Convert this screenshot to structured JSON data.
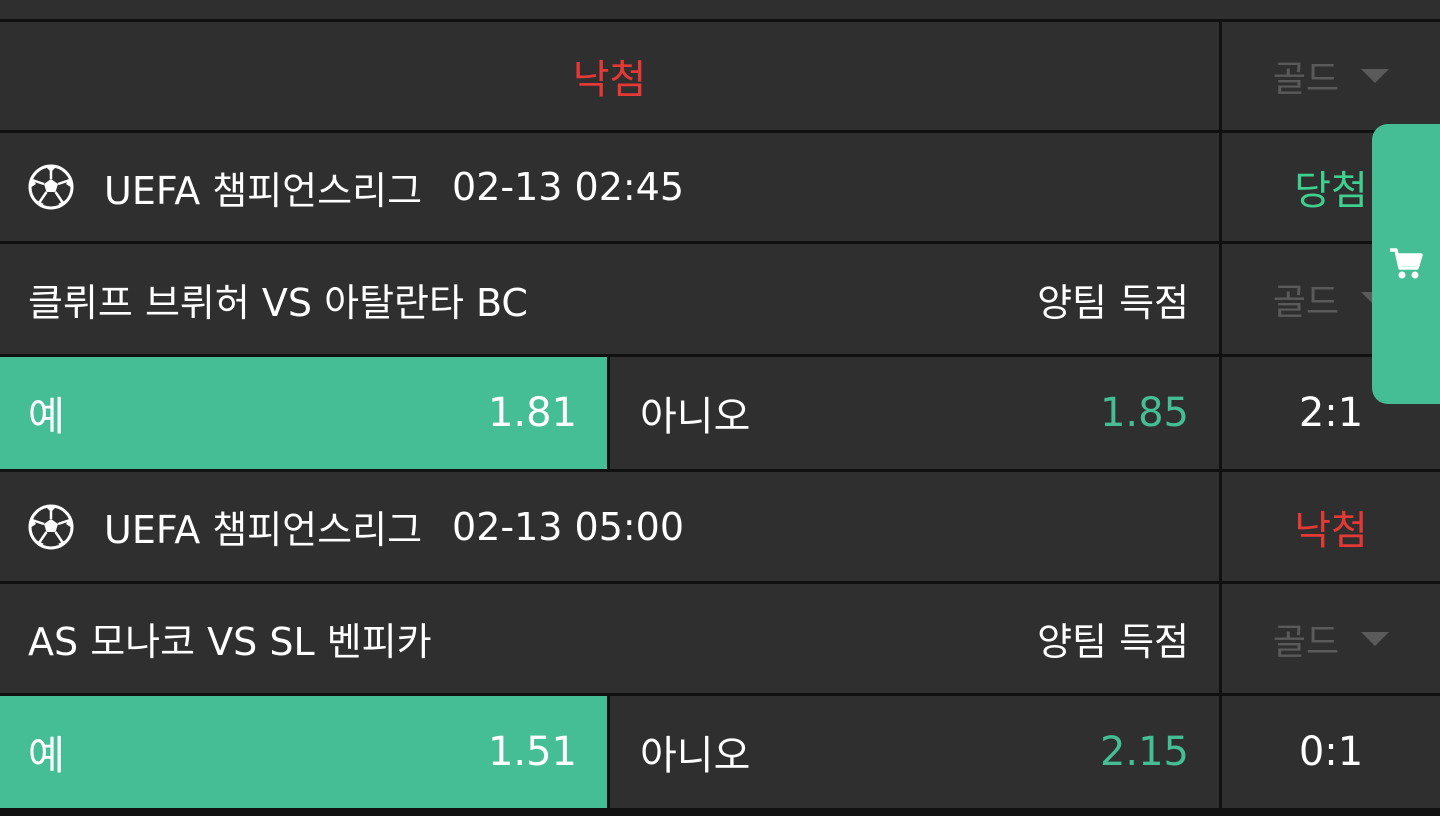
{
  "colors": {
    "accent": "#45be95",
    "win": "#3fcf8e",
    "lose": "#e53935",
    "cell_bg": "#2f2f2f",
    "muted": "#5a5a5a"
  },
  "summary": {
    "status": "낙첨",
    "grade_label": "골드"
  },
  "matches": [
    {
      "league": "UEFA 챔피언스리그",
      "datetime": "02-13 02:45",
      "result": "당첨",
      "title": "클뤼프 브뤼허 VS 아탈란타 BC",
      "bet_type": "양팀 득점",
      "grade_label": "골드",
      "options": {
        "yes_label": "예",
        "yes_odds": "1.81",
        "no_label": "아니오",
        "no_odds": "1.85"
      },
      "score": "2:1"
    },
    {
      "league": "UEFA 챔피언스리그",
      "datetime": "02-13 05:00",
      "result": "낙첨",
      "title": "AS 모나코 VS SL 벤피카",
      "bet_type": "양팀 득점",
      "grade_label": "골드",
      "options": {
        "yes_label": "예",
        "yes_odds": "1.51",
        "no_label": "아니오",
        "no_odds": "2.15"
      },
      "score": "0:1"
    }
  ],
  "icons": {
    "league": "soccer-ball-icon",
    "cart": "cart-icon",
    "dropdown": "chevron-down-icon"
  }
}
